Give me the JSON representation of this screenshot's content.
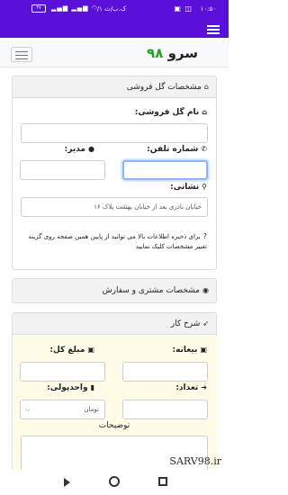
{
  "status": {
    "time": "۱۰:۵۰",
    "network": "۰/۱ ک.ب/ث",
    "battery": "۴۷"
  },
  "brand": {
    "name": "سرو",
    "number": "۹۸"
  },
  "flower_shop": {
    "header": "مشخصات گل فروشی",
    "name_label": "نام گل فروشی:",
    "phone_label": "شماره تلفن:",
    "manager_label": "مدیر:",
    "address_label": "نشانی:",
    "address_value": "خیابان نادری بعد از خیابان بهشت پلاک ۱۶",
    "help_text": "برای ذخیره اطلاعات بالا می توانید از پایین همین صفحه روی گزینه تغییر مشخصات کلیک نمایید"
  },
  "customer": {
    "header": "مشخصات مشتری و سفارش"
  },
  "job": {
    "header": "شرح کار",
    "deposit_label": "بیعانه:",
    "total_label": "مبلغ کل:",
    "quantity_label": "تعداد:",
    "unit_label": "واحدپولی:",
    "unit_value": "تومان",
    "notes_label": "توضیحات"
  },
  "watermark": "SARV98.ir"
}
